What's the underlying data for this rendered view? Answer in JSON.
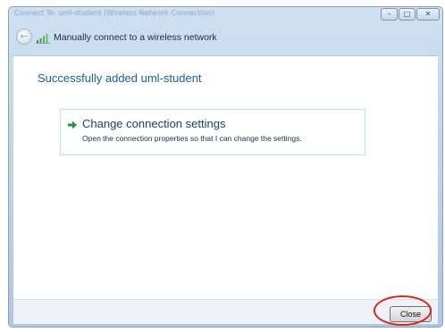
{
  "window": {
    "title": "Connect To: uml-student (Wireless Network Connection)",
    "buttons": {
      "minimize": "–",
      "maximize": "□",
      "close": "✕"
    }
  },
  "header": {
    "back_glyph": "←",
    "title": "Manually connect to a wireless network",
    "icons": [
      "back-arrow-icon",
      "wireless-network-icon"
    ]
  },
  "content": {
    "success_message": "Successfully added uml-student",
    "option": {
      "icon": "green-arrow-icon",
      "title": "Change connection settings",
      "description": "Open the connection properties so that I can change the settings."
    }
  },
  "footer": {
    "close_label": "Close"
  },
  "colors": {
    "accent_text": "#1f5b9e",
    "annotation_ring": "#d8261f",
    "option_arrow": "#1e9a3c"
  }
}
